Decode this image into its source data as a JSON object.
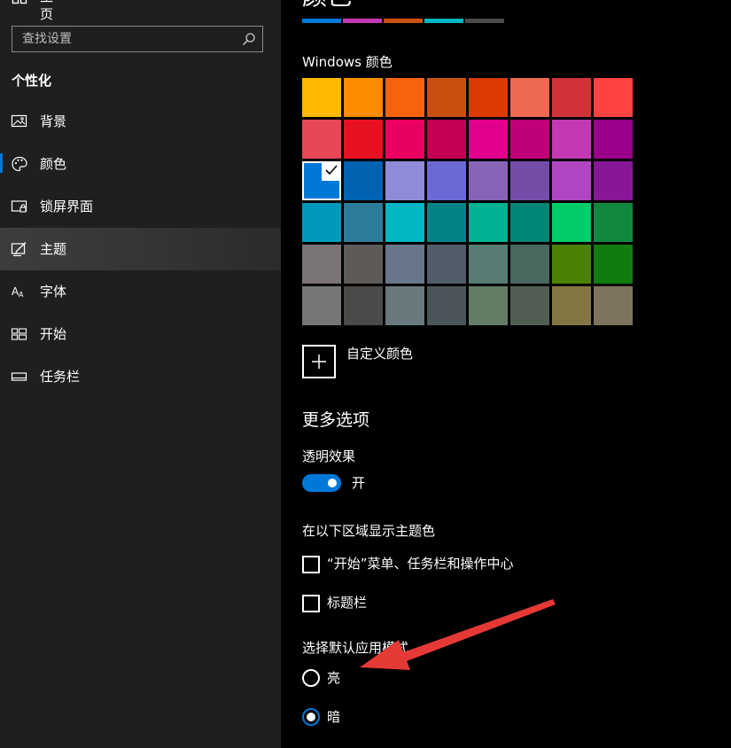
{
  "sidebar": {
    "home_label": "主页",
    "search": {
      "placeholder": "查找设置"
    },
    "section_title": "个性化",
    "items": [
      {
        "label": "背景",
        "icon": "picture-icon"
      },
      {
        "label": "颜色",
        "icon": "palette-icon"
      },
      {
        "label": "锁屏界面",
        "icon": "lock-screen-icon"
      },
      {
        "label": "主题",
        "icon": "theme-brush-icon"
      },
      {
        "label": "字体",
        "icon": "font-icon"
      },
      {
        "label": "开始",
        "icon": "start-grid-icon"
      },
      {
        "label": "任务栏",
        "icon": "taskbar-icon"
      }
    ],
    "hover_item": "主题",
    "current_page": "颜色"
  },
  "main": {
    "page_title": "颜色",
    "recent_colors": [
      "#0078d7",
      "#c239b3",
      "#ca5010",
      "#00b7c3",
      "#4c4a48"
    ],
    "windows_colors_label": "Windows 颜色",
    "swatches": [
      "#ffb900",
      "#ff8c00",
      "#f7630c",
      "#ca5010",
      "#da3b01",
      "#ef6950",
      "#d13438",
      "#ff4343",
      "#e74856",
      "#e81123",
      "#ea005e",
      "#c30052",
      "#e3008c",
      "#bf0077",
      "#c239b3",
      "#9a0089",
      "#0078d7",
      "#0063b1",
      "#8e8cd8",
      "#6b69d6",
      "#8764b8",
      "#744da9",
      "#b146c2",
      "#881798",
      "#0099bc",
      "#2d7d9a",
      "#00b7c3",
      "#038387",
      "#00b294",
      "#018574",
      "#00cc6a",
      "#10893e",
      "#7a7574",
      "#5d5a58",
      "#68768a",
      "#515c6b",
      "#567c73",
      "#486860",
      "#498205",
      "#107c10",
      "#767676",
      "#4c4a48",
      "#69797e",
      "#4a5459",
      "#647c64",
      "#525e54",
      "#847545",
      "#7e735f"
    ],
    "selected_swatch_index": 16,
    "custom_color_label": "自定义颜色",
    "more_options_heading": "更多选项",
    "transparency": {
      "label": "透明效果",
      "state_label": "开",
      "on": true
    },
    "accent_surfaces": {
      "label": "在以下区域显示主题色",
      "options": [
        {
          "label": "“开始”菜单、任务栏和操作中心",
          "checked": false
        },
        {
          "label": "标题栏",
          "checked": false
        }
      ]
    },
    "app_mode": {
      "label": "选择默认应用模式",
      "options": [
        {
          "label": "亮",
          "checked": false
        },
        {
          "label": "暗",
          "checked": true
        }
      ]
    }
  },
  "colors": {
    "accent": "#0078d7",
    "annotation_arrow": "#e53935",
    "sidebar_bg": "#1f1f1f",
    "main_bg": "#000000"
  }
}
